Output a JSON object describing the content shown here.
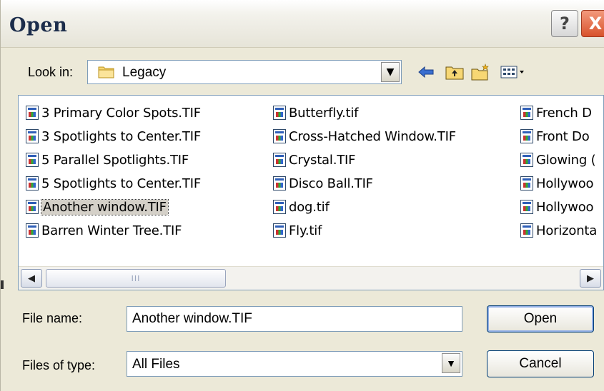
{
  "window": {
    "title": "Open"
  },
  "title_buttons": {
    "help": "?",
    "close": "X"
  },
  "look_in": {
    "label": "Look in:",
    "value": "Legacy"
  },
  "toolbar": {
    "icons": [
      "back-arrow-icon",
      "up-folder-icon",
      "new-folder-icon",
      "view-menu-icon"
    ]
  },
  "files": {
    "column1": [
      "3 Primary Color Spots.TIF",
      "3 Spotlights to Center.TIF",
      "5 Parallel Spotlights.TIF",
      "5 Spotlights to Center.TIF",
      "Another window.TIF",
      "Barren Winter Tree.TIF"
    ],
    "column2": [
      "Butterfly.tif",
      "Cross-Hatched Window.TIF",
      "Crystal.TIF",
      "Disco Ball.TIF",
      "dog.tif",
      "Fly.tif"
    ],
    "column3": [
      "French D",
      "Front Do",
      "Glowing (",
      "Hollywoo",
      "Hollywoo",
      "Horizonta"
    ],
    "selected": "Another window.TIF"
  },
  "scrollbar": {
    "grip": "III"
  },
  "file_name": {
    "label": "File name:",
    "value": "Another window.TIF"
  },
  "file_type": {
    "label": "Files of type:",
    "value": "All Files"
  },
  "buttons": {
    "open": "Open",
    "cancel": "Cancel"
  },
  "colors": {
    "accent": "#7f9db9",
    "dialog_bg": "#ece9d8",
    "close": "#d8522c"
  }
}
